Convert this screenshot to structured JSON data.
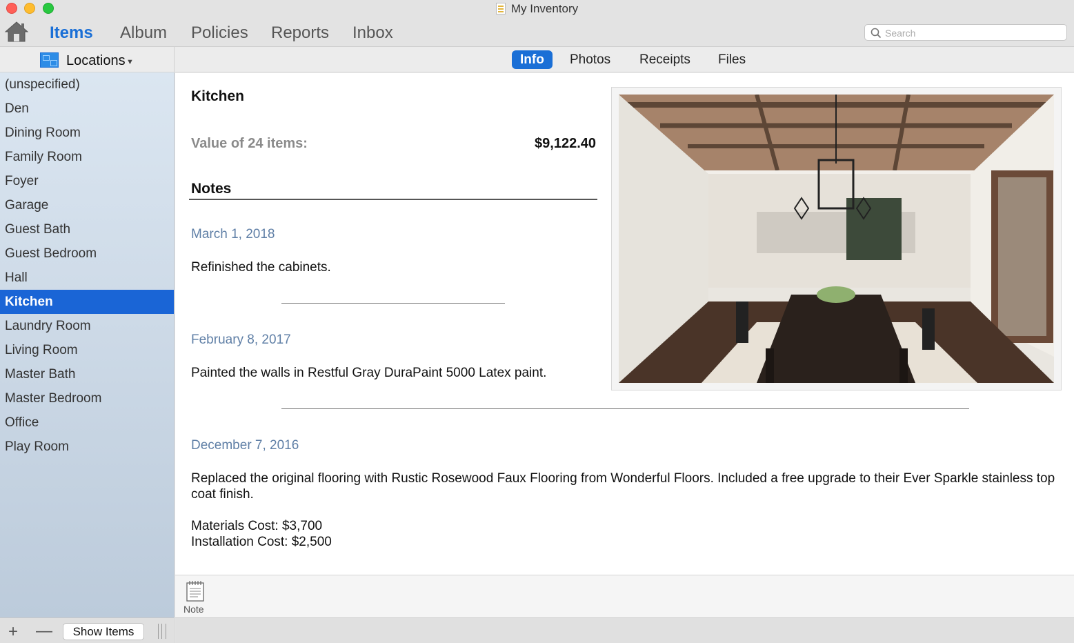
{
  "window": {
    "title": "My Inventory"
  },
  "toolbar": {
    "tabs": [
      {
        "label": "Items",
        "active": true
      },
      {
        "label": "Album",
        "active": false
      },
      {
        "label": "Policies",
        "active": false
      },
      {
        "label": "Reports",
        "active": false
      },
      {
        "label": "Inbox",
        "active": false
      }
    ],
    "search_placeholder": "Search"
  },
  "sidebar": {
    "header_label": "Locations",
    "items": [
      {
        "label": "(unspecified)"
      },
      {
        "label": "Den"
      },
      {
        "label": "Dining Room"
      },
      {
        "label": "Family Room"
      },
      {
        "label": "Foyer"
      },
      {
        "label": "Garage"
      },
      {
        "label": "Guest Bath"
      },
      {
        "label": "Guest Bedroom"
      },
      {
        "label": "Hall"
      },
      {
        "label": "Kitchen",
        "selected": true
      },
      {
        "label": "Laundry Room"
      },
      {
        "label": "Living Room"
      },
      {
        "label": "Master Bath"
      },
      {
        "label": "Master Bedroom"
      },
      {
        "label": "Office"
      },
      {
        "label": "Play Room"
      }
    ],
    "footer": {
      "add_label": "+",
      "remove_label": "—",
      "show_items_label": "Show Items"
    }
  },
  "detail_tabs": [
    {
      "label": "Info",
      "active": true
    },
    {
      "label": "Photos",
      "active": false
    },
    {
      "label": "Receipts",
      "active": false
    },
    {
      "label": "Files",
      "active": false
    }
  ],
  "detail": {
    "title": "Kitchen",
    "value_label": "Value of 24 items:",
    "value_amount": "$9,122.40",
    "notes_heading": "Notes",
    "notes": [
      {
        "date": "March 1, 2018",
        "lines": [
          "Refinished the cabinets."
        ]
      },
      {
        "date": "February 8, 2017",
        "lines": [
          "Painted the walls in Restful Gray DuraPaint 5000 Latex paint."
        ]
      },
      {
        "date": "December 7, 2016",
        "lines": [
          "Replaced the original flooring with Rustic Rosewood Faux Flooring from Wonderful Floors. Included a free upgrade to their Ever Sparkle stainless top coat finish.",
          "",
          "Materials Cost: $3,700",
          "Installation Cost: $2,500"
        ]
      }
    ]
  },
  "attachments": {
    "note_label": "Note"
  },
  "colors": {
    "accent": "#1a6fd6",
    "selection": "#1a65d6",
    "date_text": "#5f7fa6"
  }
}
